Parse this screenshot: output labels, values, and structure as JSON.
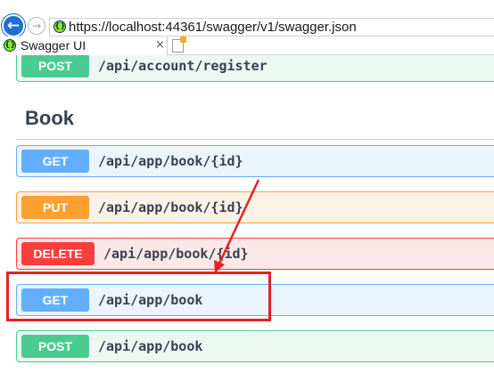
{
  "browser": {
    "back_glyph": "←",
    "forward_glyph": "→",
    "site_icon_glyph": "{}",
    "url": "https://localhost:44361/swagger/v1/swagger.json",
    "tab_title": "Swagger UI",
    "tab_close_glyph": "×"
  },
  "operations_top": [
    {
      "method": "POST",
      "path": "/api/account/register"
    }
  ],
  "section": {
    "title": "Book",
    "operations": [
      {
        "method": "GET",
        "path": "/api/app/book/{id}"
      },
      {
        "method": "PUT",
        "path": "/api/app/book/{id}"
      },
      {
        "method": "DELETE",
        "path": "/api/app/book/{id}"
      },
      {
        "method": "GET",
        "path": "/api/app/book"
      },
      {
        "method": "POST",
        "path": "/api/app/book"
      }
    ]
  },
  "annotation": {
    "color": "#e32323",
    "icons": [
      "highlight-box",
      "arrow-pointer"
    ]
  },
  "colors": {
    "post": "#49cc90",
    "get": "#61affe",
    "put": "#fca130",
    "delete": "#f93e3e",
    "swagger_green": "#85ea2d"
  }
}
